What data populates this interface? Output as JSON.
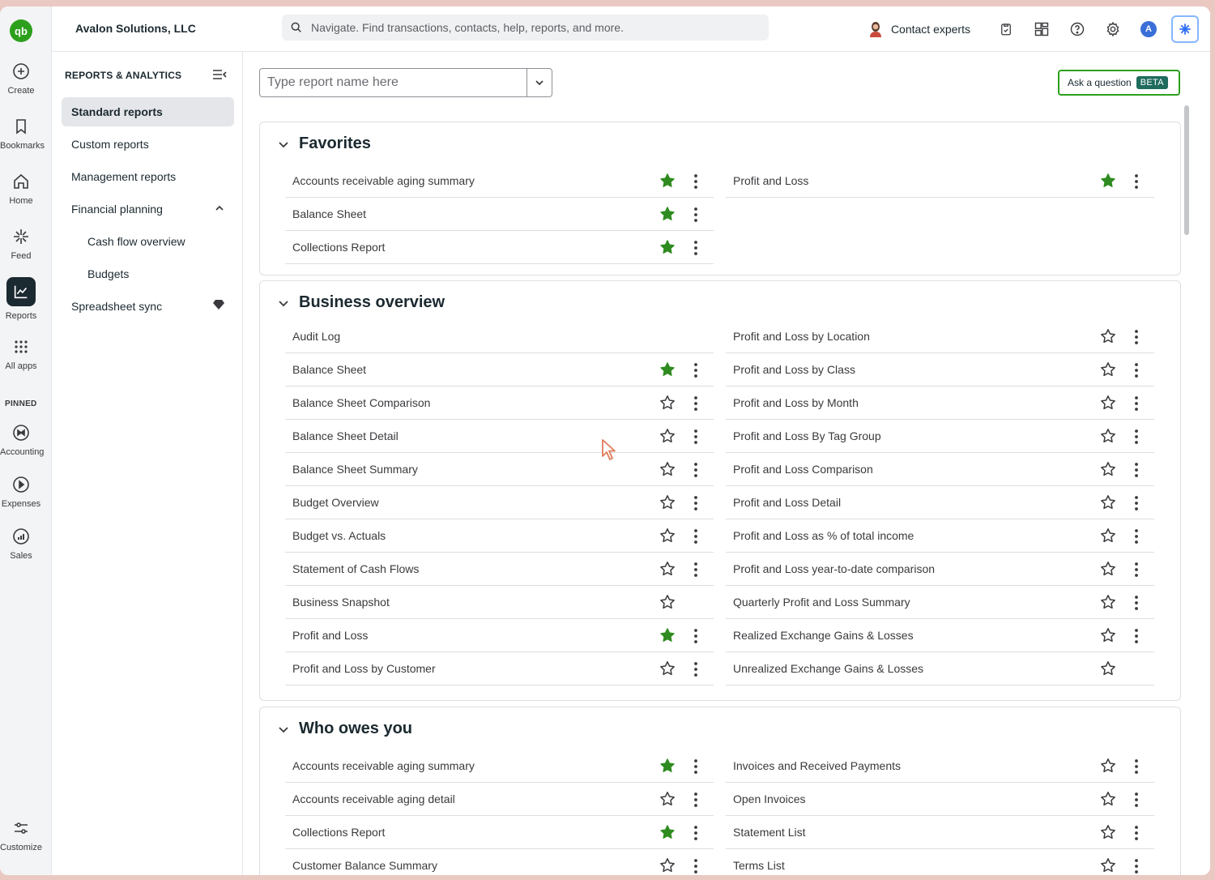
{
  "company_name": "Avalon Solutions, LLC",
  "search": {
    "placeholder": "Navigate. Find transactions, contacts, help, reports, and more."
  },
  "topbar": {
    "contact_experts": "Contact experts",
    "avatar_initial": "A"
  },
  "rail": {
    "items": [
      {
        "label": "Create",
        "icon": "plus-circle-icon"
      },
      {
        "label": "Bookmarks",
        "icon": "bookmark-icon"
      },
      {
        "label": "Home",
        "icon": "home-icon"
      },
      {
        "label": "Feed",
        "icon": "sparkle-icon"
      },
      {
        "label": "Reports",
        "icon": "chart-line-icon",
        "active": true
      },
      {
        "label": "All apps",
        "icon": "grid-dots-icon"
      }
    ],
    "pinned_label": "PINNED",
    "pinned": [
      {
        "label": "Accounting",
        "icon": "accounting-icon"
      },
      {
        "label": "Expenses",
        "icon": "expenses-icon"
      },
      {
        "label": "Sales",
        "icon": "sales-icon"
      }
    ],
    "customize_label": "Customize"
  },
  "sidebar": {
    "heading": "REPORTS & ANALYTICS",
    "items": [
      {
        "label": "Standard reports",
        "selected": true
      },
      {
        "label": "Custom reports"
      },
      {
        "label": "Management reports"
      },
      {
        "label": "Financial planning",
        "expanded": true
      },
      {
        "label": "Cash flow overview",
        "sub": true
      },
      {
        "label": "Budgets",
        "sub": true
      },
      {
        "label": "Spreadsheet sync",
        "badge": "diamond-icon"
      }
    ]
  },
  "main": {
    "report_search_placeholder": "Type report name here",
    "ask_question": "Ask a question",
    "beta": "BETA"
  },
  "sections": [
    {
      "title": "Favorites",
      "left": [
        {
          "name": "Accounts receivable aging summary",
          "favorite": true,
          "menu": true
        },
        {
          "name": "Balance Sheet",
          "favorite": true,
          "menu": true
        },
        {
          "name": "Collections Report",
          "favorite": true,
          "menu": true
        }
      ],
      "right": [
        {
          "name": "Profit and Loss",
          "favorite": true,
          "menu": true
        }
      ]
    },
    {
      "title": "Business overview",
      "left": [
        {
          "name": "Audit Log",
          "favorite": null,
          "menu": false
        },
        {
          "name": "Balance Sheet",
          "favorite": true,
          "menu": true
        },
        {
          "name": "Balance Sheet Comparison",
          "favorite": false,
          "menu": true
        },
        {
          "name": "Balance Sheet Detail",
          "favorite": false,
          "menu": true
        },
        {
          "name": "Balance Sheet Summary",
          "favorite": false,
          "menu": true
        },
        {
          "name": "Budget Overview",
          "favorite": false,
          "menu": true
        },
        {
          "name": "Budget vs. Actuals",
          "favorite": false,
          "menu": true
        },
        {
          "name": "Statement of Cash Flows",
          "favorite": false,
          "menu": true
        },
        {
          "name": "Business Snapshot",
          "favorite": false,
          "menu": false
        },
        {
          "name": "Profit and Loss",
          "favorite": true,
          "menu": true
        },
        {
          "name": "Profit and Loss by Customer",
          "favorite": false,
          "menu": true
        }
      ],
      "right": [
        {
          "name": "Profit and Loss by Location",
          "favorite": false,
          "menu": true
        },
        {
          "name": "Profit and Loss by Class",
          "favorite": false,
          "menu": true
        },
        {
          "name": "Profit and Loss by Month",
          "favorite": false,
          "menu": true
        },
        {
          "name": "Profit and Loss By Tag Group",
          "favorite": false,
          "menu": true
        },
        {
          "name": "Profit and Loss Comparison",
          "favorite": false,
          "menu": true
        },
        {
          "name": "Profit and Loss Detail",
          "favorite": false,
          "menu": true
        },
        {
          "name": "Profit and Loss as % of total income",
          "favorite": false,
          "menu": true
        },
        {
          "name": "Profit and Loss year-to-date comparison",
          "favorite": false,
          "menu": true
        },
        {
          "name": "Quarterly Profit and Loss Summary",
          "favorite": false,
          "menu": true
        },
        {
          "name": "Realized Exchange Gains & Losses",
          "favorite": false,
          "menu": true
        },
        {
          "name": "Unrealized Exchange Gains & Losses",
          "favorite": false,
          "menu": false
        }
      ]
    },
    {
      "title": "Who owes you",
      "left": [
        {
          "name": "Accounts receivable aging summary",
          "favorite": true,
          "menu": true
        },
        {
          "name": "Accounts receivable aging detail",
          "favorite": false,
          "menu": true
        },
        {
          "name": "Collections Report",
          "favorite": true,
          "menu": true
        },
        {
          "name": "Customer Balance Summary",
          "favorite": false,
          "menu": true
        }
      ],
      "right": [
        {
          "name": "Invoices and Received Payments",
          "favorite": false,
          "menu": true
        },
        {
          "name": "Open Invoices",
          "favorite": false,
          "menu": true
        },
        {
          "name": "Statement List",
          "favorite": false,
          "menu": true
        },
        {
          "name": "Terms List",
          "favorite": false,
          "menu": true
        }
      ]
    }
  ],
  "colors": {
    "brand_green": "#2ca01c",
    "star_green": "#2e8b1f",
    "text": "#393a3d",
    "rail_active": "#1b2930"
  }
}
